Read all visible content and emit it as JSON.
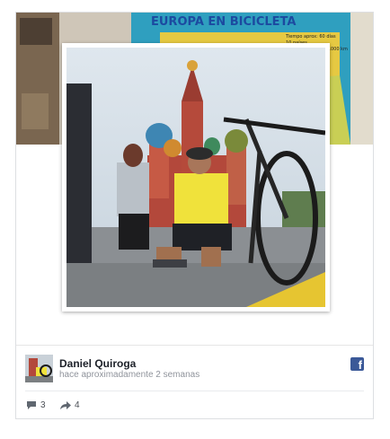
{
  "cover": {
    "banner_title": "EUROPA EN BICICLETA",
    "banner_lines": [
      "Tiempo aprox: 60 días",
      "10 países",
      "Rusia  Distancia: + de 5.000 km"
    ]
  },
  "post": {
    "author_name": "Daniel Quiroga",
    "timestamp": "hace aproximadamente 2 semanas",
    "source_icon": "facebook-icon",
    "brand_color": "#3b5998"
  },
  "stats": {
    "comments_count": "3",
    "shares_count": "4"
  },
  "icons": {
    "comment": "comment-icon",
    "share": "share-icon"
  }
}
